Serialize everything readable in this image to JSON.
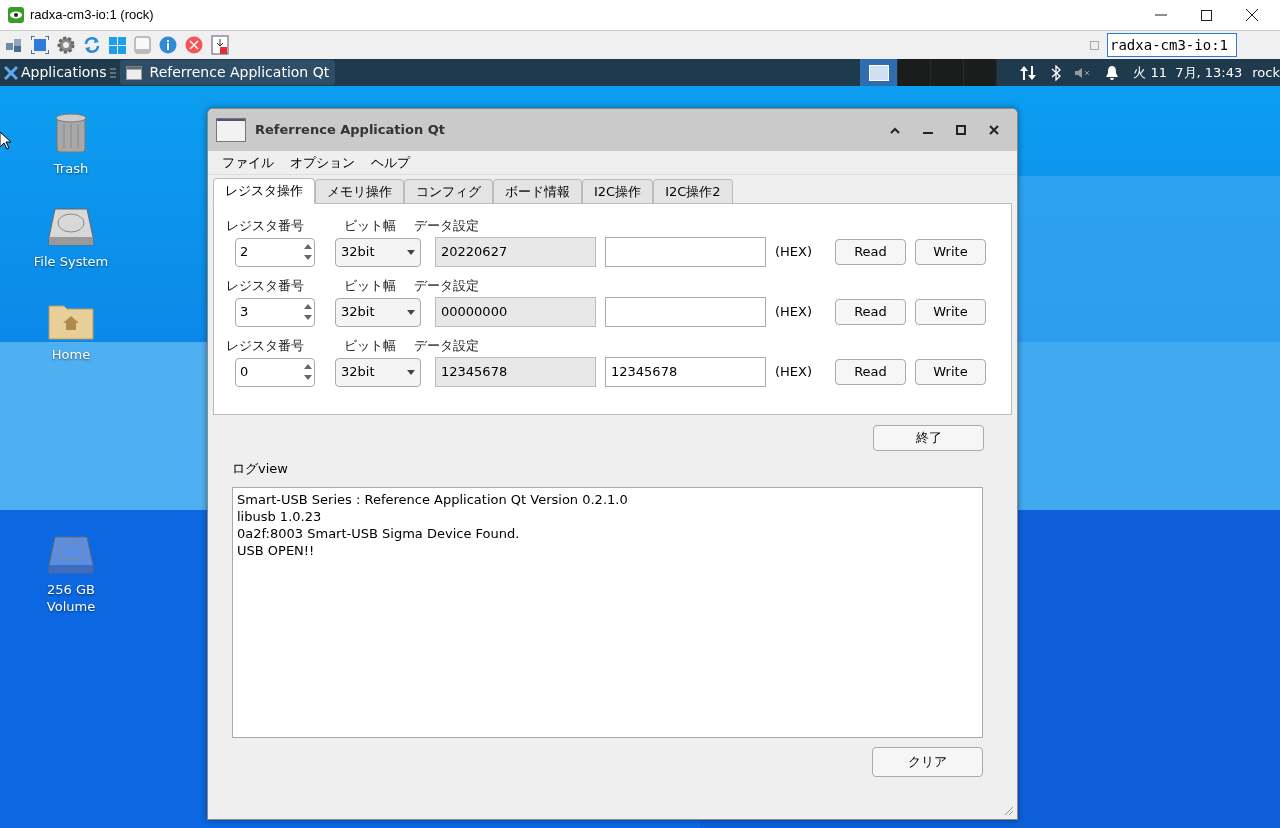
{
  "vnc": {
    "title": "radxa-cm3-io:1 (rock)",
    "host_field": "radxa-cm3-io:1"
  },
  "panel": {
    "applications": "Applications",
    "task": "Referrence Application Qt",
    "workspaces": [
      {
        "selected": true
      },
      {
        "selected": false
      },
      {
        "selected": false
      },
      {
        "selected": false
      }
    ],
    "clock": "火 11  7月, 13:43",
    "user": "rock"
  },
  "desktop_icons": [
    {
      "kind": "trash",
      "label": "Trash"
    },
    {
      "kind": "drive",
      "label": "File System"
    },
    {
      "kind": "home",
      "label": "Home"
    },
    {
      "kind": "volume",
      "label": "256 GB Volume"
    }
  ],
  "app": {
    "title": "Referrence Application Qt",
    "menu": [
      "ファイル",
      "オプション",
      "ヘルプ"
    ],
    "tabs": [
      {
        "label": "レジスタ操作",
        "selected": true
      },
      {
        "label": "メモリ操作",
        "selected": false
      },
      {
        "label": "コンフィグ",
        "selected": false
      },
      {
        "label": "ボード情報",
        "selected": false
      },
      {
        "label": "I2C操作",
        "selected": false
      },
      {
        "label": "I2C操作2",
        "selected": false
      }
    ],
    "rows": [
      {
        "reg_label": "レジスタ番号",
        "reg": "2",
        "width_label": "ビット幅",
        "width": "32bit",
        "data_label": "データ設定",
        "read_value": "20220627",
        "write_value": "",
        "unit": "(HEX)",
        "read": "Read",
        "write": "Write"
      },
      {
        "reg_label": "レジスタ番号",
        "reg": "3",
        "width_label": "ビット幅",
        "width": "32bit",
        "data_label": "データ設定",
        "read_value": "00000000",
        "write_value": "",
        "unit": "(HEX)",
        "read": "Read",
        "write": "Write"
      },
      {
        "reg_label": "レジスタ番号",
        "reg": "0",
        "width_label": "ビット幅",
        "width": "32bit",
        "data_label": "データ設定",
        "read_value": "12345678",
        "write_value": "12345678",
        "unit": "(HEX)",
        "read": "Read",
        "write": "Write"
      }
    ],
    "quit": "終了",
    "log_label": "ログview",
    "log": [
      "Smart-USB Series : Reference Application Qt Version 0.2.1.0",
      "libusb 1.0.23",
      "0a2f:8003 Smart-USB Sigma Device Found.",
      "USB OPEN!!"
    ],
    "clear": "クリア"
  }
}
